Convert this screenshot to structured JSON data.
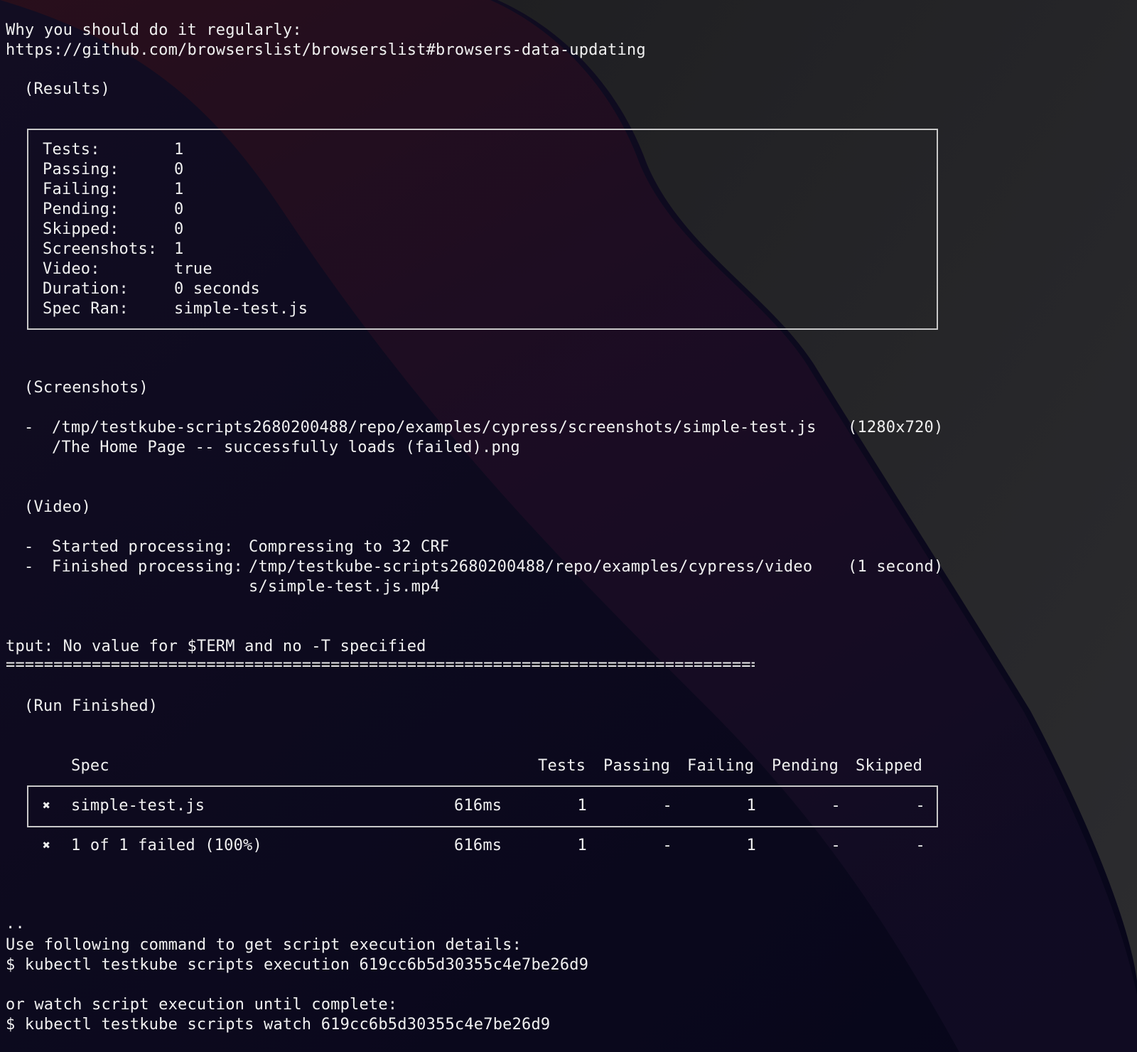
{
  "intro": {
    "line1": "Why you should do it regularly:",
    "line2": "https://github.com/browserslist/browserslist#browsers-data-updating"
  },
  "results": {
    "heading": "(Results)",
    "rows": [
      {
        "label": "Tests:",
        "value": "1"
      },
      {
        "label": "Passing:",
        "value": "0"
      },
      {
        "label": "Failing:",
        "value": "1"
      },
      {
        "label": "Pending:",
        "value": "0"
      },
      {
        "label": "Skipped:",
        "value": "0"
      },
      {
        "label": "Screenshots:",
        "value": "1"
      },
      {
        "label": "Video:",
        "value": "true"
      },
      {
        "label": "Duration:",
        "value": "0 seconds"
      },
      {
        "label": "Spec Ran:",
        "value": "simple-test.js"
      }
    ]
  },
  "screenshots": {
    "heading": "(Screenshots)",
    "bullet": "-",
    "path1": "/tmp/testkube-scripts2680200488/repo/examples/cypress/screenshots/simple-test.js",
    "path2": "/The Home Page -- successfully loads (failed).png",
    "dimensions": "(1280x720)"
  },
  "video": {
    "heading": "(Video)",
    "started_label": "Started processing:",
    "started_value": "Compressing to 32 CRF",
    "finished_label": "Finished processing:",
    "finished_value1": "/tmp/testkube-scripts2680200488/repo/examples/cypress/video",
    "finished_value2": "s/simple-test.js.mp4",
    "finished_time": "(1 second)"
  },
  "tput_warning": "tput: No value for $TERM and no -T specified",
  "separator": "================================================================================",
  "run_finished": {
    "heading": "(Run Finished)",
    "headers": [
      "Spec",
      "Tests",
      "Passing",
      "Failing",
      "Pending",
      "Skipped"
    ],
    "row": {
      "status_icon": "✖",
      "spec": "simple-test.js",
      "duration": "616ms",
      "tests": "1",
      "passing": "-",
      "failing": "1",
      "pending": "-",
      "skipped": "-"
    },
    "summary": {
      "status_icon": "✖",
      "text": "1 of 1 failed (100%)",
      "duration": "616ms",
      "tests": "1",
      "passing": "-",
      "failing": "1",
      "pending": "-",
      "skipped": "-"
    }
  },
  "footer": {
    "dots": "..",
    "details_label": "Use following command to get script execution details:",
    "details_cmd": "$ kubectl testkube scripts execution 619cc6b5d30355c4e7be26d9",
    "watch_label": "or watch script execution until complete:",
    "watch_cmd": "$ kubectl testkube scripts watch 619cc6b5d30355c4e7be26d9"
  },
  "colors": {
    "background_dark": "#0d0b1a",
    "background_red": "#2a0f1e",
    "background_gray": "#2a2a2c",
    "text": "#f0f0f0",
    "box_border": "#c9c9c9"
  }
}
